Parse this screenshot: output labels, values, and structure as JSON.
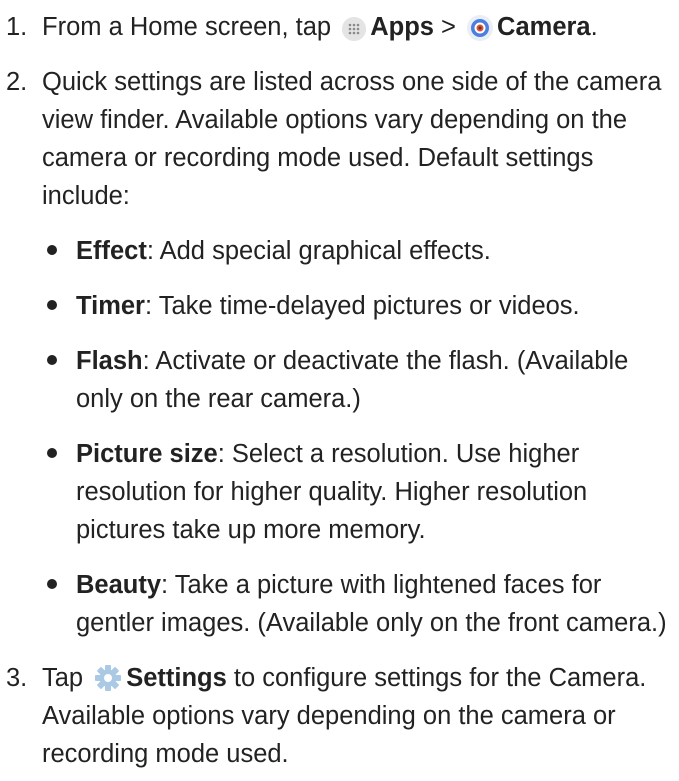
{
  "steps": [
    {
      "number": "1.",
      "parts": {
        "lead": "From a Home screen, tap",
        "apps_icon": "apps-icon",
        "apps_label": "Apps",
        "separator": ">",
        "camera_icon": "camera-icon",
        "camera_label": "Camera",
        "end": "."
      }
    },
    {
      "number": "2.",
      "text": "Quick settings are listed across one side of the camera view finder. Available options vary depending on the camera or recording mode used. Default settings include:",
      "bullets": [
        {
          "term": "Effect",
          "desc": ": Add special graphical effects."
        },
        {
          "term": "Timer",
          "desc": ": Take time-delayed pictures or videos."
        },
        {
          "term": "Flash",
          "desc": ": Activate or deactivate the flash. (Available only on the rear camera.)"
        },
        {
          "term": "Picture size",
          "desc": ": Select a resolution. Use higher resolution for higher quality. Higher resolution pictures take up more memory."
        },
        {
          "term": "Beauty",
          "desc": ": Take a picture with lightened faces for gentler images. (Available only on the front camera.)"
        }
      ]
    },
    {
      "number": "3.",
      "parts": {
        "lead": "Tap",
        "settings_icon": "gear-icon",
        "settings_label": "Settings",
        "rest": " to configure settings for the Camera. Available options vary depending on the camera or recording mode used."
      }
    }
  ],
  "colors": {
    "text": "#222222",
    "camera_icon_blue": "#4a7fe0",
    "gear_icon": "#a9c9e4"
  }
}
